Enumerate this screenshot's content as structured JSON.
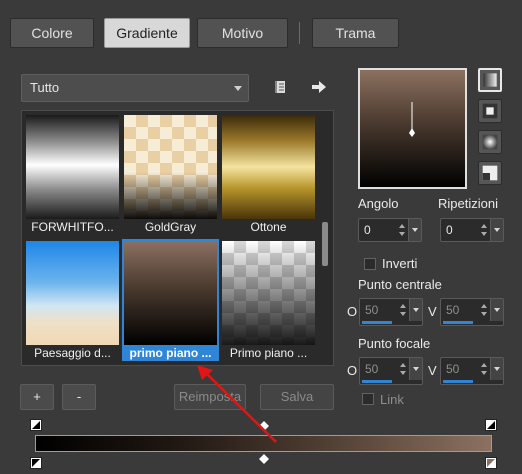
{
  "tabs": [
    {
      "label": "Colore",
      "active": false
    },
    {
      "label": "Gradiente",
      "active": true
    },
    {
      "label": "Motivo",
      "active": false
    },
    {
      "label": "Trama",
      "active": false
    }
  ],
  "category_dropdown": {
    "value": "Tutto"
  },
  "gallery": {
    "items": [
      {
        "label": "FORWHITFO...",
        "selected": false
      },
      {
        "label": "GoldGray",
        "selected": false
      },
      {
        "label": "Ottone",
        "selected": false
      },
      {
        "label": "Paesaggio d...",
        "selected": false
      },
      {
        "label": "primo piano ...",
        "selected": true
      },
      {
        "label": "Primo piano ...",
        "selected": false
      }
    ]
  },
  "buttons": {
    "add": "+",
    "remove": "-",
    "reset": "Reimposta",
    "save": "Salva"
  },
  "angle": {
    "label": "Angolo",
    "value": "0"
  },
  "repeats": {
    "label": "Ripetizioni",
    "value": "0"
  },
  "invert": {
    "label": "Inverti",
    "checked": false
  },
  "center_point": {
    "label": "Punto centrale",
    "h_label": "O",
    "h_value": "50",
    "v_label": "V",
    "v_value": "50"
  },
  "focal_point": {
    "label": "Punto focale",
    "h_label": "O",
    "h_value": "50",
    "v_label": "V",
    "v_value": "50"
  },
  "link": {
    "label": "Link",
    "checked": false
  },
  "colors": {
    "accent": "#2f86d6",
    "arrow": "#e01515",
    "gradient_start": "#000000",
    "gradient_end": "#8c7160"
  }
}
